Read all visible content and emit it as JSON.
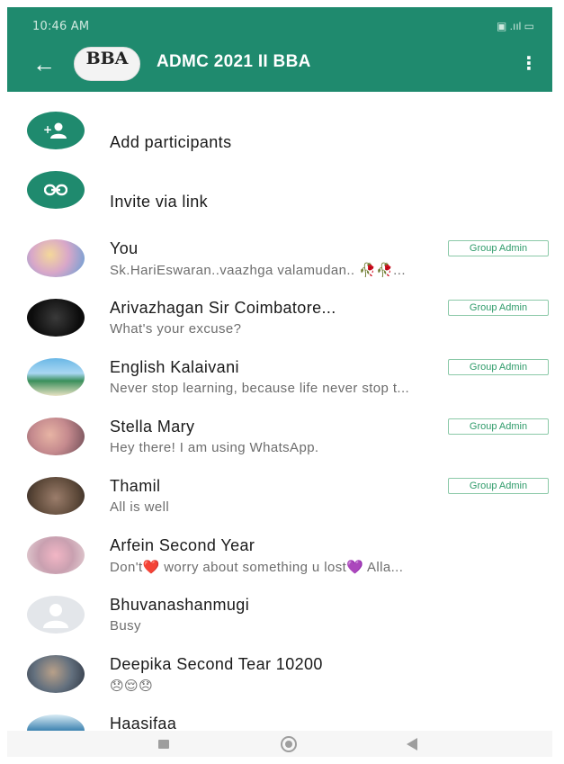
{
  "status_bar": {
    "time": "10:46 AM",
    "indicators": "▣ .ııl ▭"
  },
  "app_bar": {
    "back_icon": "arrow-left-icon",
    "group_avatar_text": "BBA",
    "group_name": "ADMC 2021 II BBA",
    "menu_icon": "more-vert-icon",
    "menu_glyph": "⋮"
  },
  "actions": [
    {
      "label": "Add participants",
      "icon": "add-person-icon",
      "glyph": "+☻"
    },
    {
      "label": "Invite via link",
      "icon": "link-icon",
      "glyph": "⚯"
    }
  ],
  "participants": [
    {
      "name": "You",
      "status": "Sk.HariEswaran..vaazhga valamudan.. 🥀🥀...",
      "admin": "Group Admin"
    },
    {
      "name": "Arivazhagan Sir Coimbatore...",
      "status": "What's your excuse?",
      "admin": "Group Admin"
    },
    {
      "name": "English Kalaivani",
      "status": "Never stop learning, because life never stop t...",
      "admin": "Group Admin"
    },
    {
      "name": "Stella Mary",
      "status": "Hey there! I am using WhatsApp.",
      "admin": "Group Admin"
    },
    {
      "name": "Thamil",
      "status": "All is well",
      "admin": "Group Admin"
    },
    {
      "name": "Arfein Second Year",
      "status": "Don't❤️ worry about something u lost💜 Alla...",
      "admin": ""
    },
    {
      "name": "Bhuvanashanmugi",
      "status": "Busy",
      "admin": ""
    },
    {
      "name": "Deepika Second Tear 10200",
      "status": "😞😌😞",
      "admin": ""
    },
    {
      "name": "Haasifaa",
      "status": "",
      "admin": ""
    }
  ],
  "nav_bar": {
    "recent_icon": "recent-apps-icon",
    "home_icon": "home-icon",
    "back_icon": "back-triangle-icon"
  },
  "colors": {
    "header": "#1f8a6e",
    "admin_badge_text": "#2f9b6a",
    "admin_badge_border": "#8bc9a8"
  }
}
